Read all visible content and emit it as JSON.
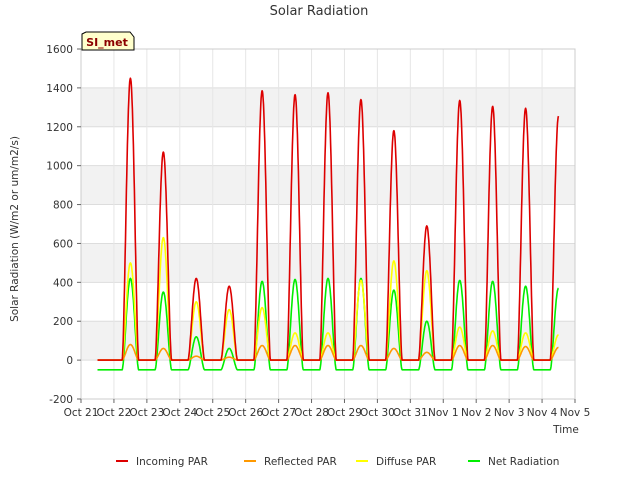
{
  "chart_data": {
    "type": "line",
    "title": "Solar Radiation",
    "xlabel": "Time",
    "ylabel": "Solar Radiation (W/m2 or um/m2/s)",
    "badge": "SI_met",
    "ylim": [
      -200,
      1600
    ],
    "xlim": [
      0,
      15
    ],
    "yticks": [
      -200,
      0,
      200,
      400,
      600,
      800,
      1000,
      1200,
      1400,
      1600
    ],
    "xticks": [
      {
        "x": 0,
        "label": "Oct 21"
      },
      {
        "x": 1,
        "label": "Oct 22"
      },
      {
        "x": 2,
        "label": "Oct 23"
      },
      {
        "x": 3,
        "label": "Oct 24"
      },
      {
        "x": 4,
        "label": "Oct 25"
      },
      {
        "x": 5,
        "label": "Oct 26"
      },
      {
        "x": 6,
        "label": "Oct 27"
      },
      {
        "x": 7,
        "label": "Oct 28"
      },
      {
        "x": 8,
        "label": "Oct 29"
      },
      {
        "x": 9,
        "label": "Oct 30"
      },
      {
        "x": 10,
        "label": "Oct 31"
      },
      {
        "x": 11,
        "label": "Nov 1"
      },
      {
        "x": 12,
        "label": "Nov 2"
      },
      {
        "x": 13,
        "label": "Nov 3"
      },
      {
        "x": 14,
        "label": "Nov 4"
      },
      {
        "x": 15,
        "label": "Nov 5"
      }
    ],
    "grid": true,
    "legend_position": "bottom",
    "series": [
      {
        "name": "Incoming PAR",
        "color": "#dd0000",
        "day_peaks": [
          1450,
          1070,
          420,
          380,
          1385,
          1365,
          1375,
          1340,
          1180,
          690,
          1335,
          1305,
          1295,
          1255
        ]
      },
      {
        "name": "Reflected PAR",
        "color": "#ff9900",
        "day_peaks": [
          80,
          60,
          20,
          15,
          75,
          75,
          75,
          75,
          60,
          40,
          75,
          75,
          70,
          65
        ]
      },
      {
        "name": "Diffuse PAR",
        "color": "#ffff00",
        "day_peaks": [
          500,
          630,
          300,
          260,
          270,
          140,
          140,
          410,
          510,
          460,
          170,
          150,
          140,
          130
        ]
      },
      {
        "name": "Net Radiation",
        "color": "#00ee00",
        "day_peaks": [
          420,
          350,
          120,
          60,
          405,
          415,
          420,
          420,
          360,
          200,
          410,
          405,
          380,
          370
        ],
        "night_value": -50
      }
    ]
  }
}
